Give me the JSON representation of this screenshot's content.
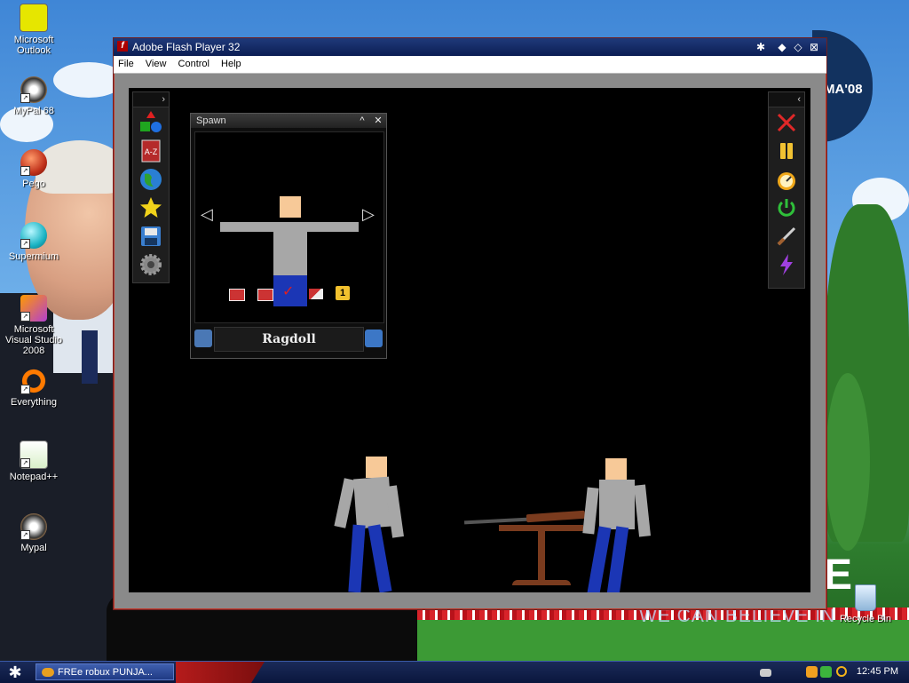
{
  "desktop": {
    "icons": [
      {
        "label": "Microsoft Outlook"
      },
      {
        "label": "MyPal 68"
      },
      {
        "label": "Pego"
      },
      {
        "label": "Supermium"
      },
      {
        "label": "Microsoft Visual Studio 2008"
      },
      {
        "label": "Everything"
      },
      {
        "label": "Notepad++"
      },
      {
        "label": "Mypal"
      },
      {
        "label": "Recycle Bin"
      }
    ],
    "wallpaper_logo_text": "MA'08",
    "wallpaper_slogan": "WE CAN BELIEVE IN",
    "wallpaper_big_letter": "E"
  },
  "window": {
    "title": "Adobe Flash Player 32",
    "menu": [
      "File",
      "View",
      "Control",
      "Help"
    ],
    "flash_icon": "f"
  },
  "spawn_panel": {
    "title": "Spawn",
    "selected_name": "Ragdoll",
    "prev_arrow": "◁",
    "next_arrow": "▷",
    "count_badge": "1"
  },
  "left_toolbar_icons": [
    "shapes-icon",
    "a-z-icon",
    "globe-icon",
    "star-icon",
    "save-icon",
    "gear-icon"
  ],
  "right_toolbar_icons": [
    "close-x-icon",
    "pause-icon",
    "stopwatch-icon",
    "power-icon",
    "knife-icon",
    "lightning-icon"
  ],
  "taskbar": {
    "start_glyph": "✱",
    "task_label": "FREe robux PUNJA...",
    "clock": "12:45 PM"
  },
  "colors": {
    "skin": "#f7c998",
    "shirt": "#a7a7a7",
    "jeans": "#1b36b5",
    "stage": "#000000",
    "taskbar": "#0a163d"
  }
}
